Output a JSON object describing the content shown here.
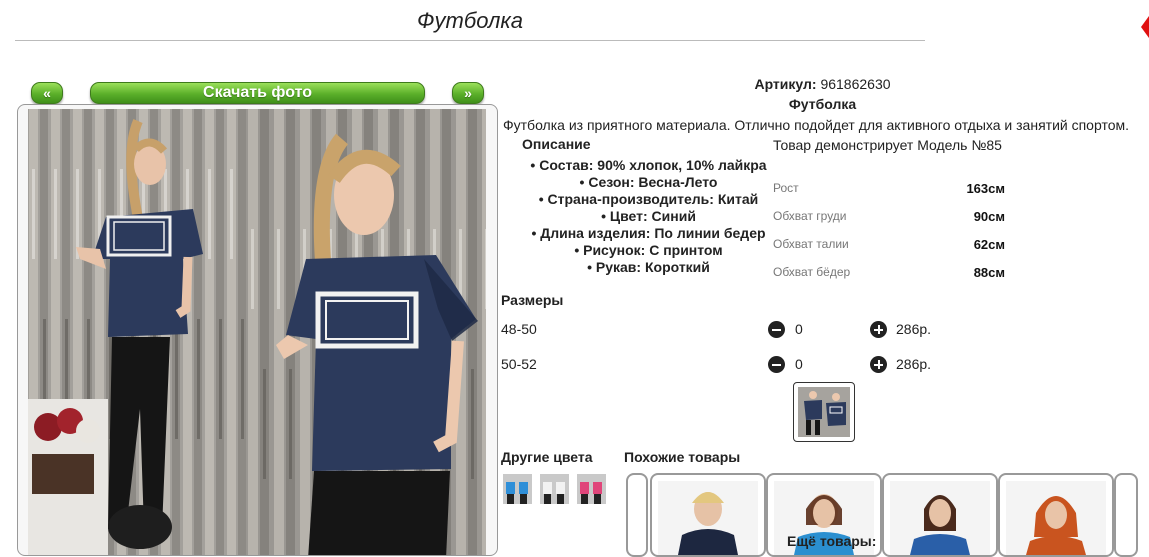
{
  "product": {
    "title": "Футболка",
    "article_label": "Артикул:",
    "article_value": "961862630",
    "name": "Футболка",
    "description": "Футболка из приятного материала. Отлично подойдет для активного отдыха и занятий спортом.",
    "description_label": "Описание",
    "properties": [
      "Состав: 90% хлопок, 10% лайкра",
      "Сезон: Весна-Лето",
      "Страна-производитель: Китай",
      "Цвет: Синий",
      "Длина изделия: По линии бедер",
      "Рисунок: С принтом",
      "Рукав: Короткий"
    ]
  },
  "gallery": {
    "prev_label": "«",
    "download_label": "Скачать фото",
    "next_label": "»"
  },
  "model": {
    "heading": "Товар демонстрирует Модель №85",
    "rows": [
      {
        "label": "Рост",
        "value": "163см"
      },
      {
        "label": "Обхват груди",
        "value": "90см"
      },
      {
        "label": "Обхват талии",
        "value": "62см"
      },
      {
        "label": "Обхват бёдер",
        "value": "88см"
      }
    ]
  },
  "sizes": {
    "label": "Размеры",
    "rows": [
      {
        "size": "48-50",
        "qty": "0",
        "price": "286р."
      },
      {
        "size": "50-52",
        "qty": "0",
        "price": "286р."
      }
    ]
  },
  "other_colors": {
    "label": "Другие цвета"
  },
  "similar": {
    "label": "Похожие товары",
    "more_label": "Ещё товары:"
  },
  "colors": {
    "accent_green": "#5bb02a",
    "garment_navy": "#2c3a5c",
    "brand_red": "#e01010"
  }
}
